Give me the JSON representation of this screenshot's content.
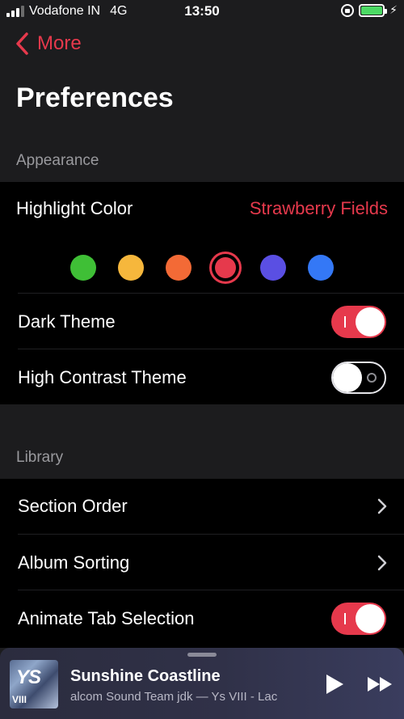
{
  "status_bar": {
    "carrier": "Vodafone IN",
    "network": "4G",
    "time": "13:50",
    "battery_level": 1.0
  },
  "nav": {
    "back_label": "More",
    "title": "Preferences"
  },
  "appearance": {
    "header": "Appearance",
    "highlight_color_label": "Highlight Color",
    "highlight_color_value": "Strawberry Fields",
    "swatches": [
      {
        "name": "green",
        "color": "#3fbf36"
      },
      {
        "name": "yellow",
        "color": "#f6b73c"
      },
      {
        "name": "orange",
        "color": "#f36a36"
      },
      {
        "name": "strawberry",
        "color": "#e6394c",
        "selected": true
      },
      {
        "name": "indigo",
        "color": "#5a4fe3"
      },
      {
        "name": "blue",
        "color": "#3478f6"
      }
    ],
    "dark_theme_label": "Dark Theme",
    "dark_theme_on": true,
    "high_contrast_label": "High Contrast Theme",
    "high_contrast_on": false
  },
  "library": {
    "header": "Library",
    "section_order_label": "Section Order",
    "album_sorting_label": "Album Sorting",
    "animate_tab_label": "Animate Tab Selection",
    "animate_tab_on": true
  },
  "mini_player": {
    "title": "Sunshine Coastline",
    "subtitle": "alcom Sound Team jdk — Ys VIII - Lac",
    "artwork_text": "YS",
    "artwork_sub": "VIII"
  },
  "colors": {
    "accent": "#e6394c",
    "background": "#1c1c1e",
    "group_background": "#000000"
  }
}
